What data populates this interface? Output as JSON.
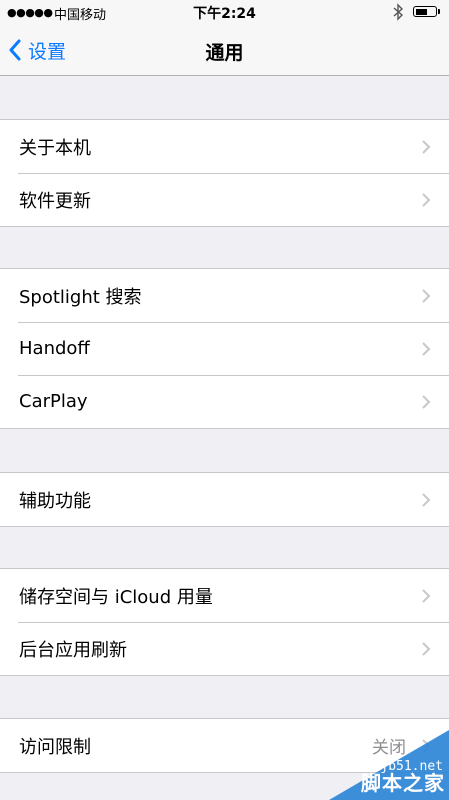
{
  "status_bar": {
    "signal": "●●●●●",
    "carrier": "中国移动",
    "time": "下午2:24"
  },
  "nav": {
    "back_label": "设置",
    "title": "通用"
  },
  "groups": [
    {
      "items": [
        {
          "label": "关于本机"
        },
        {
          "label": "软件更新"
        }
      ]
    },
    {
      "items": [
        {
          "label": "Spotlight 搜索"
        },
        {
          "label": "Handoff"
        },
        {
          "label": "CarPlay"
        }
      ]
    },
    {
      "items": [
        {
          "label": "辅助功能"
        }
      ]
    },
    {
      "items": [
        {
          "label": "储存空间与 iCloud 用量"
        },
        {
          "label": "后台应用刷新"
        }
      ]
    },
    {
      "items": [
        {
          "label": "访问限制",
          "value": "关闭"
        }
      ]
    }
  ],
  "watermark": {
    "domain": "jb51.net",
    "name": "脚本之家"
  },
  "colors": {
    "accent": "#0a7aff",
    "background": "#efeff4",
    "separator": "#c8c7cc",
    "secondary_text": "#8e8e93"
  }
}
